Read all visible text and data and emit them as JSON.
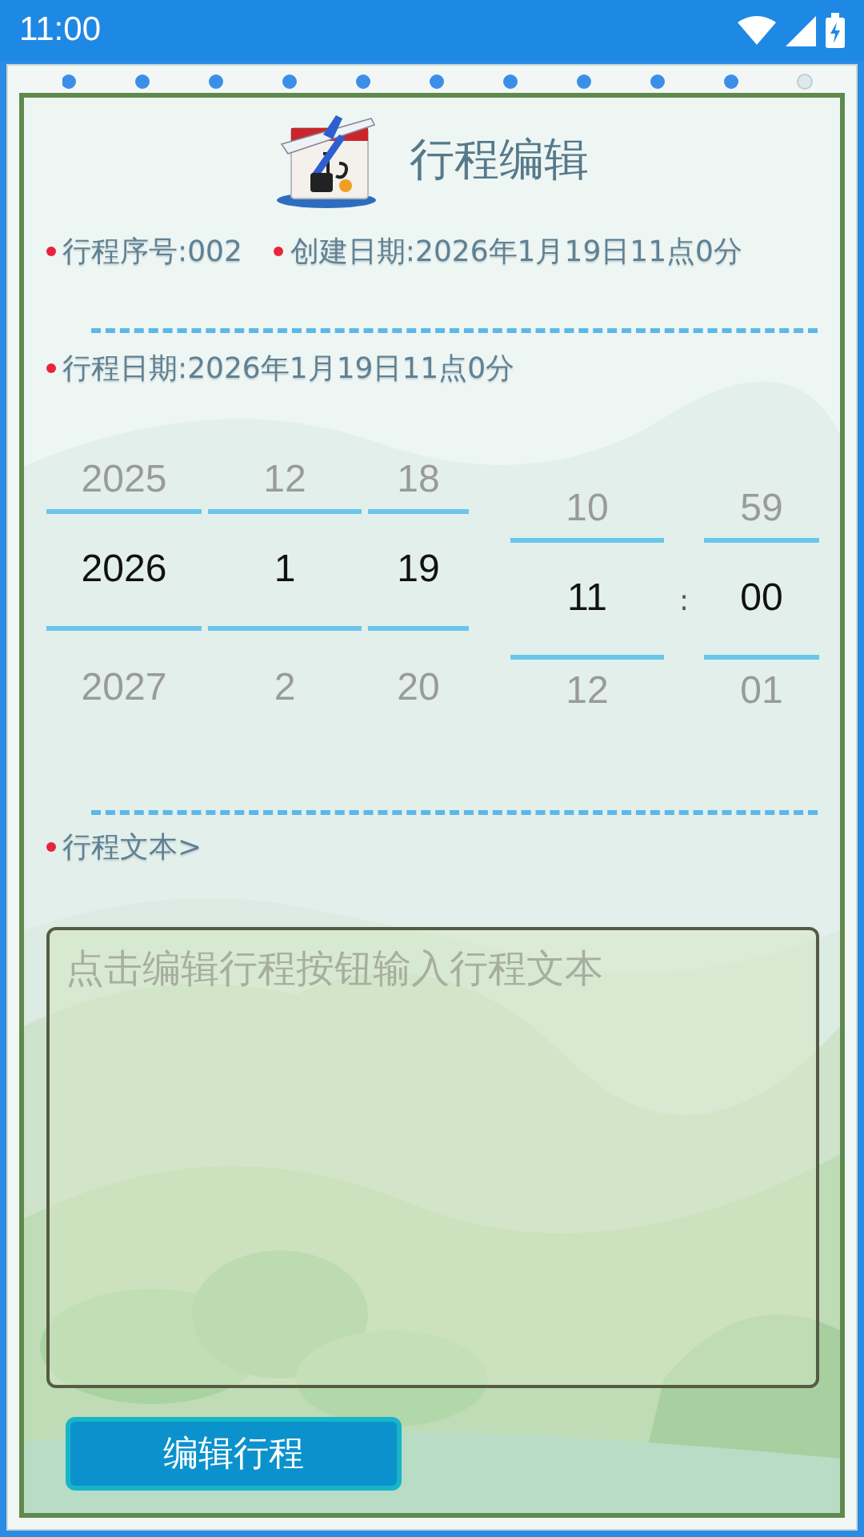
{
  "status_bar": {
    "time": "11:00"
  },
  "header": {
    "title": "行程编辑"
  },
  "info": [
    {
      "label": "行程序号:002"
    },
    {
      "label": "创建日期:2026年1月19日11点0分"
    }
  ],
  "trip_date": {
    "label": "行程日期:2026年1月19日11点0分"
  },
  "picker": {
    "separator": ":",
    "columns": [
      {
        "kind": "date",
        "prev": "2025",
        "current": "2026",
        "next": "2027"
      },
      {
        "kind": "date",
        "prev": "12",
        "current": "1",
        "next": "2"
      },
      {
        "kind": "date",
        "prev": "18",
        "current": "19",
        "next": "20"
      },
      {
        "kind": "time",
        "prev": "10",
        "current": "11",
        "next": "12"
      },
      {
        "kind": "time",
        "prev": "59",
        "current": "00",
        "next": "01"
      }
    ]
  },
  "text_section": {
    "label": "行程文本>",
    "placeholder": "点击编辑行程按钮输入行程文本"
  },
  "buttons": [
    "编辑行程"
  ]
}
